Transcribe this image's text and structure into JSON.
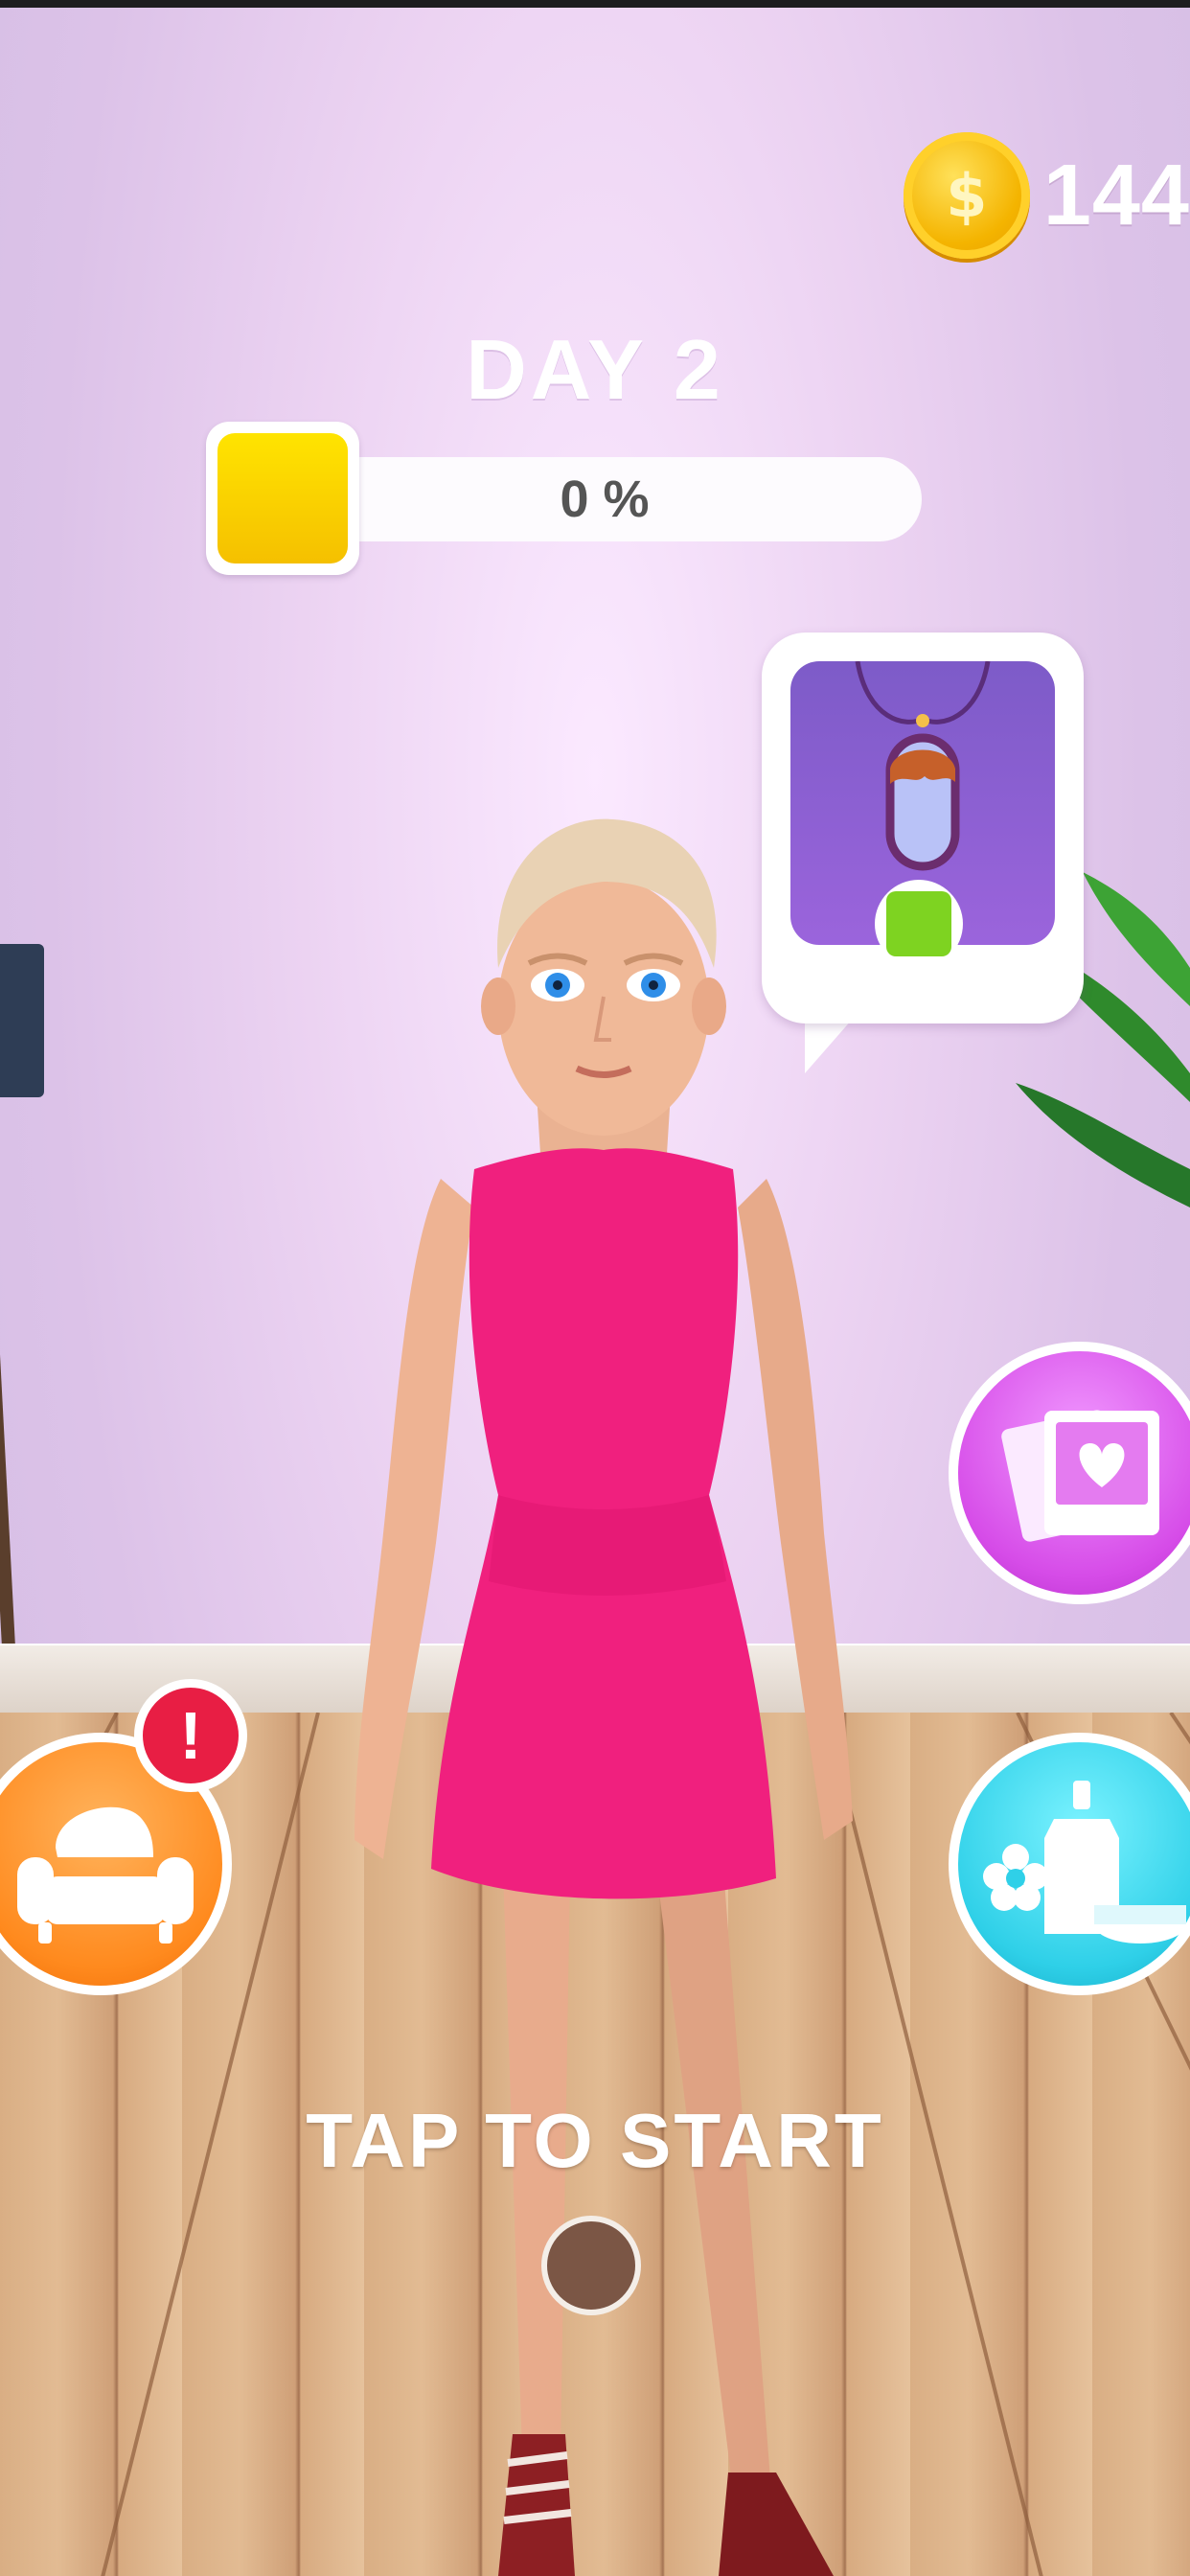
{
  "hud": {
    "coin_symbol": "$",
    "coin_count": "144",
    "day_label": "DAY 2",
    "progress_text": "0 %",
    "progress_fraction": 0.0
  },
  "request_bubble": {
    "item_icon": "pendant-necklace-icon",
    "status_icon": "green-check-box-icon"
  },
  "buttons": {
    "album_icon": "photo-album-heart-icon",
    "shop_icon": "cosmetics-shop-icon",
    "furniture_icon": "armchair-icon",
    "alert_symbol": "!"
  },
  "start_prompt": "TAP TO START",
  "colors": {
    "wall": "#e5cdf0",
    "coin": "#f4b400",
    "progress_badge": "#ffd400",
    "dress": "#f0207e",
    "album_button": "#d64ce8",
    "shop_button": "#2fd0e8",
    "furniture_button": "#ff8a1e",
    "alert": "#e81e44"
  }
}
